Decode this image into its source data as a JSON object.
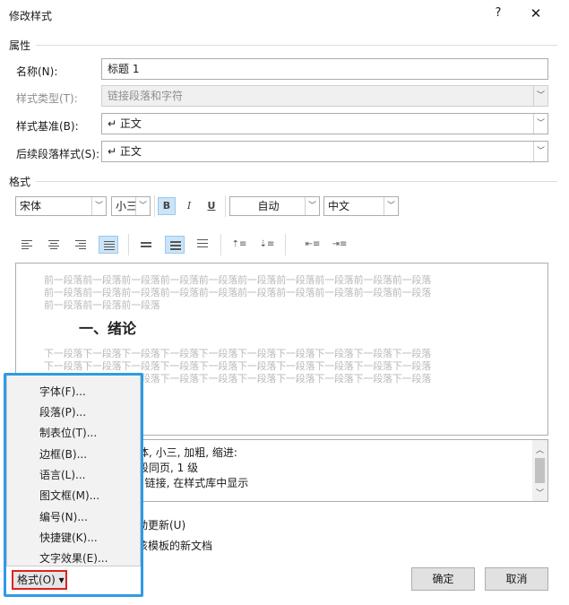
{
  "window": {
    "title": "修改样式",
    "help": "?",
    "close": "✕"
  },
  "properties": {
    "heading": "属性",
    "name_label": "名称(N):",
    "name_value": "标题 1",
    "type_label": "样式类型(T):",
    "type_value": "链接段落和字符",
    "based_label": "样式基准(B):",
    "based_value": "↵ 正文",
    "next_label": "后续段落样式(S):",
    "next_value": "↵ 正文"
  },
  "format": {
    "heading": "格式",
    "font": "宋体",
    "size": "小三",
    "bold": "B",
    "italic": "I",
    "underline": "U",
    "color": "自动",
    "language": "中文"
  },
  "preview": {
    "prev_lines": [
      "前一段落前一段落前一段落前一段落前一段落前一段落前一段落前一段落前一段落前一段落",
      "前一段落前一段落前一段落前一段落前一段落前一段落前一段落前一段落前一段落前一段落",
      "前一段落前一段落前一段落"
    ],
    "heading": "一、绪论",
    "next_lines": [
      "下一段落下一段落下一段落下一段落下一段落下一段落下一段落下一段落下一段落下一段落",
      "下一段落下一段落下一段落下一段落下一段落下一段落下一段落下一段落下一段落下一段落",
      "下一段落下一段落下一段落下一段落下一段落下一段落下一段落下一段落下一段落下一段落"
    ]
  },
  "description": {
    "line1": "体, 小三, 加粗, 缩进:",
    "line2": "段同页, 1 级",
    "line3": ", 链接, 在样式库中显示"
  },
  "options": {
    "auto_update": "动更新(U)",
    "new_docs": "该模板的新文档"
  },
  "menu": {
    "items": [
      "字体(F)...",
      "段落(P)...",
      "制表位(T)...",
      "边框(B)...",
      "语言(L)...",
      "图文框(M)...",
      "编号(N)...",
      "快捷键(K)...",
      "文字效果(E)..."
    ]
  },
  "buttons": {
    "format": "格式(O) ▾",
    "ok": "确定",
    "cancel": "取消"
  }
}
